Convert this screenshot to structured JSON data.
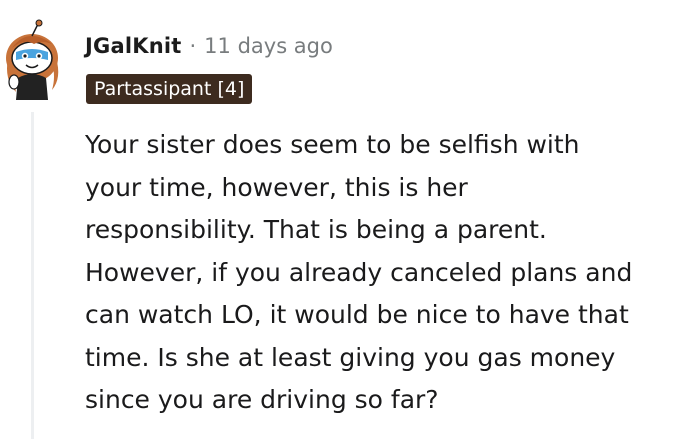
{
  "comment": {
    "username": "JGalKnit",
    "separator": "·",
    "timestamp": "11 days ago",
    "flair": "Partassipant [4]",
    "avatar_icon": "snoo-avatar-icon",
    "body_lines": [
      "Your sister does seem to be selfish with",
      "your time, however, this is her",
      "responsibility. That is being a parent.",
      "However, if you already canceled plans and",
      "can watch LO, it would be nice to have that",
      "time. Is she at least giving you gas money",
      "since you are driving so far?"
    ]
  },
  "colors": {
    "flair_bg": "#3d2b1f",
    "muted_text": "#787c7e",
    "thread_line": "#edeff1"
  }
}
